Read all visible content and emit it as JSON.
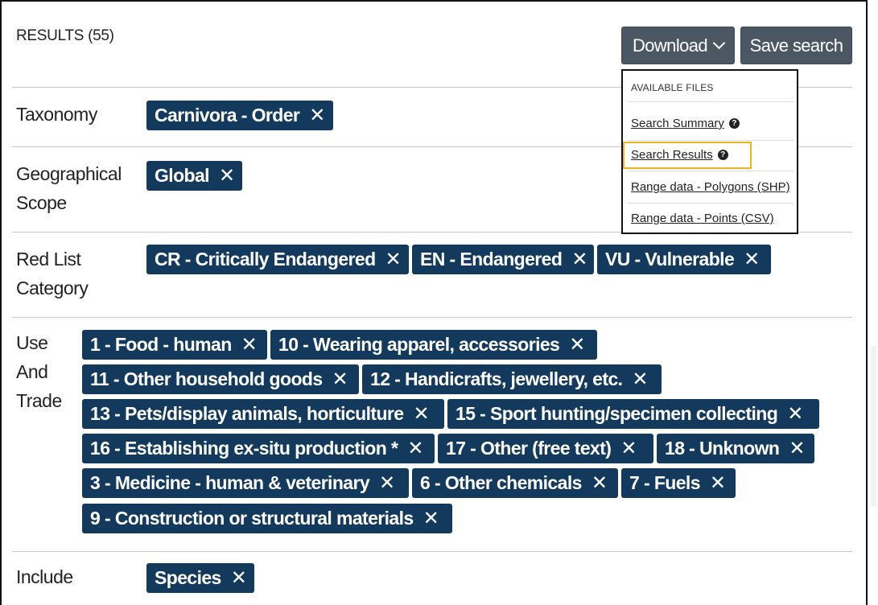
{
  "results": {
    "title": "RESULTS (55)"
  },
  "toolbar": {
    "download_label": "Download",
    "save_label": "Save search"
  },
  "dropdown": {
    "header": "AVAILABLE FILES",
    "items": [
      {
        "label": "Search Summary",
        "help": true
      },
      {
        "label": "Search Results",
        "help": true,
        "highlighted": true
      },
      {
        "label": "Range data - Polygons (SHP)",
        "help": false
      },
      {
        "label": "Range data - Points (CSV)",
        "help": false
      }
    ]
  },
  "filters": {
    "taxonomy": {
      "label": "Taxonomy",
      "chips": [
        "Carnivora - Order"
      ]
    },
    "geo": {
      "label_line1": "Geographical",
      "label_line2": "Scope",
      "chips": [
        "Global"
      ]
    },
    "redlist": {
      "label_line1": "Red List",
      "label_line2": "Category",
      "chips": [
        "CR - Critically Endangered",
        "EN - Endangered",
        "VU - Vulnerable"
      ]
    },
    "use": {
      "label_line1": "Use",
      "label_line2": "And",
      "label_line3": "Trade",
      "chips": [
        "1 - Food - human",
        "10 - Wearing apparel, accessories",
        "11 - Other household goods",
        "12 - Handicrafts, jewellery, etc.",
        "13 - Pets/display animals, horticulture",
        "15 - Sport hunting/specimen collecting",
        "16 - Establishing ex-situ production *",
        "17 - Other (free text)",
        "18 - Unknown",
        "3 - Medicine - human & veterinary",
        "6 - Other chemicals",
        "7 - Fuels",
        "9 - Construction or structural materials"
      ]
    },
    "include": {
      "label": "Include",
      "chips": [
        "Species"
      ]
    }
  },
  "chip_remove_glyph": "✕",
  "colors": {
    "chip_bg": "#133a5c",
    "button_bg": "#4b5863",
    "highlight": "#f0b323"
  }
}
